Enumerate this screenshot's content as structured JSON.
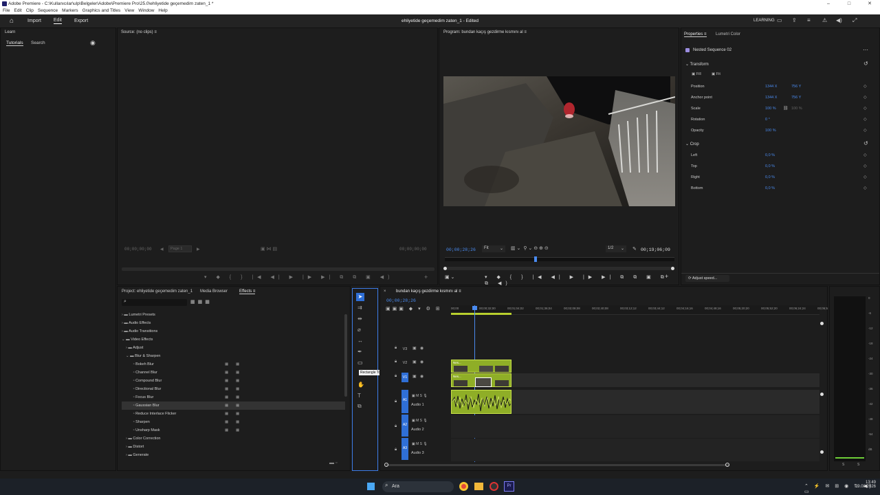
{
  "window": {
    "title": "Adobe Premiere - C:\\Kullanıcılar\\ulp\\Belgeler\\Adobe\\Premiere Pro\\25.0\\ehliyetide geçemedim zaten_1 *"
  },
  "menu": [
    "File",
    "Edit",
    "Clip",
    "Sequence",
    "Markers",
    "Graphics and Titles",
    "View",
    "Window",
    "Help"
  ],
  "appbar": {
    "tabs": [
      "Import",
      "Edit",
      "Export"
    ],
    "active_tab": "Edit",
    "project_title": "ehliyetide geçemedim zaten_1",
    "edited": "- Edited",
    "learning": "LEARNING"
  },
  "learn_panel": {
    "title": "Learn",
    "tabs": [
      "Tutorials",
      "Search"
    ]
  },
  "source_monitor": {
    "title": "Source: (no clips)",
    "tc_left": "00;00;00;00",
    "tc_right": "00;00;00;00",
    "page": "Page 1"
  },
  "program_monitor": {
    "title": "Program: bundan kaçış gezdirme kısmını al",
    "timecode": "00;00;28;26",
    "fit": "Fit",
    "resolution": "1/2",
    "duration": "00;19;06;09"
  },
  "properties": {
    "tabs": [
      "Properties",
      "Lumetri Color"
    ],
    "item": "Nested Sequence 02",
    "transform_title": "Transform",
    "fill": "Fill",
    "fit": "Fit",
    "rows": [
      {
        "label": "Position",
        "v1": "1344 X",
        "v2": "756 Y"
      },
      {
        "label": "Anchor point",
        "v1": "1344 X",
        "v2": "756 Y"
      },
      {
        "label": "Scale",
        "v1": "100 %",
        "v2": "100 %"
      },
      {
        "label": "Rotation",
        "v1": "0 °",
        "v2": ""
      },
      {
        "label": "Opacity",
        "v1": "100 %",
        "v2": ""
      }
    ],
    "crop_title": "Crop",
    "crop_rows": [
      {
        "label": "Left",
        "v1": "0,0 %"
      },
      {
        "label": "Top",
        "v1": "0,0 %"
      },
      {
        "label": "Right",
        "v1": "0,0 %"
      },
      {
        "label": "Bottom",
        "v1": "0,0 %"
      }
    ],
    "adjust_speed": "Adjust speed..."
  },
  "effects_panel": {
    "tabs": [
      "Project: ehliyetide geçemedim zaten_1",
      "Media Browser",
      "Effects"
    ],
    "active_tab": "Effects",
    "tree": [
      {
        "label": "Lumetri Presets",
        "indent": 0,
        "type": "folder"
      },
      {
        "label": "Audio Effects",
        "indent": 0,
        "type": "folder"
      },
      {
        "label": "Audio Transitions",
        "indent": 0,
        "type": "folder"
      },
      {
        "label": "Video Effects",
        "indent": 0,
        "type": "folder-open"
      },
      {
        "label": "Adjust",
        "indent": 1,
        "type": "folder"
      },
      {
        "label": "Blur & Sharpen",
        "indent": 1,
        "type": "folder-open"
      },
      {
        "label": "Bokeh Blur",
        "indent": 2,
        "type": "fx"
      },
      {
        "label": "Channel Blur",
        "indent": 2,
        "type": "fx"
      },
      {
        "label": "Compound Blur",
        "indent": 2,
        "type": "fx"
      },
      {
        "label": "Directional Blur",
        "indent": 2,
        "type": "fx"
      },
      {
        "label": "Focus Blur",
        "indent": 2,
        "type": "fx"
      },
      {
        "label": "Gaussian Blur",
        "indent": 2,
        "type": "fx",
        "selected": true
      },
      {
        "label": "Reduce Interlace Flicker",
        "indent": 2,
        "type": "fx"
      },
      {
        "label": "Sharpen",
        "indent": 2,
        "type": "fx"
      },
      {
        "label": "Unsharp Mask",
        "indent": 2,
        "type": "fx"
      },
      {
        "label": "Color Correction",
        "indent": 1,
        "type": "folder"
      },
      {
        "label": "Distort",
        "indent": 1,
        "type": "folder"
      },
      {
        "label": "Generate",
        "indent": 1,
        "type": "folder"
      }
    ]
  },
  "tools": {
    "tooltip": "Rectangle Tool"
  },
  "timeline": {
    "title": "bundan kaçış gezdirme kısmını al",
    "timecode": "00;00;28;26",
    "ruler": [
      "00;00",
      "00;00;32;00",
      "00;01;04;02",
      "00;01;36;04",
      "00;02;08;08",
      "00;02;40;08",
      "00;03;12;12",
      "00;03;44;12",
      "00;04;16;16",
      "00;04;48;16",
      "00;05;20;20",
      "00;05;52;20",
      "00;06;24;24",
      "00;06;5"
    ],
    "video_tracks": [
      "V3",
      "V2",
      "V1"
    ],
    "audio_tracks": [
      {
        "id": "A1",
        "name": "Audio 1"
      },
      {
        "id": "A2",
        "name": "Audio 2"
      },
      {
        "id": "A3",
        "name": "Audio 3"
      }
    ],
    "clip_label": "Nes..."
  },
  "meter": {
    "scale": [
      "0",
      "-6",
      "-12",
      "-18",
      "-24",
      "-30",
      "-36",
      "-42",
      "-48",
      "-54",
      "dB"
    ],
    "bottom": [
      "S",
      "S"
    ]
  },
  "taskbar": {
    "search": "Ara",
    "time": "13:49",
    "date": "9.08.2026"
  }
}
